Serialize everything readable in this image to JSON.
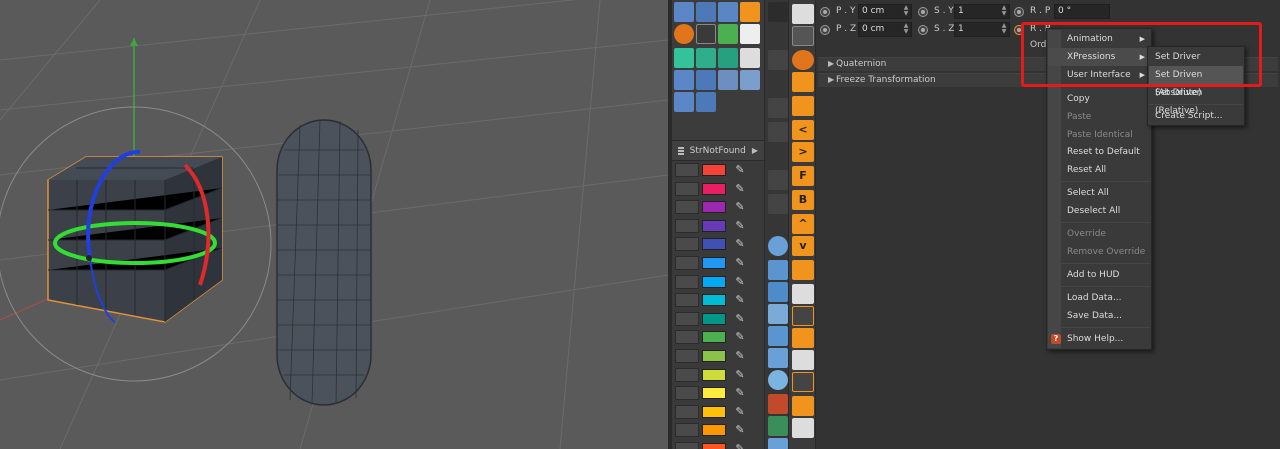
{
  "coords": {
    "row1": {
      "p_label": "P . Y",
      "p_value": "0 cm",
      "s_label": "S . Y",
      "s_value": "1",
      "r_label": "R . P",
      "r_value": "0 °"
    },
    "row2": {
      "p_label": "P . Z",
      "p_value": "0 cm",
      "s_label": "S . Z",
      "s_value": "1",
      "r_label": "R . B",
      "r_value": ""
    },
    "order_label": "Ord"
  },
  "groups": [
    {
      "label": "Quaternion"
    },
    {
      "label": "Freeze Transformation"
    }
  ],
  "layer_panel": {
    "header_label": "StrNotFound",
    "swatch_colors": [
      "#f44336",
      "#e91e63",
      "#9c27b0",
      "#673ab7",
      "#3f51b5",
      "#2196f3",
      "#03a9f4",
      "#00bcd4",
      "#009688",
      "#4caf50",
      "#8bc34a",
      "#cddc39",
      "#ffeb3b",
      "#ffc107",
      "#ff9800",
      "#ff5722"
    ]
  },
  "context_menu": {
    "items": [
      {
        "label": "Animation",
        "submenu": true
      },
      {
        "label": "XPressions",
        "submenu": true,
        "highlighted": true
      },
      {
        "label": "User Interface",
        "submenu": true
      },
      {
        "label": "Copy"
      },
      {
        "label": "Paste",
        "disabled": true
      },
      {
        "label": "Paste Identical",
        "disabled": true
      },
      {
        "label": "Reset to Default"
      },
      {
        "label": "Reset All"
      },
      {
        "label": "Select All"
      },
      {
        "label": "Deselect All"
      },
      {
        "label": "Override",
        "disabled": true
      },
      {
        "label": "Remove Override",
        "disabled": true
      },
      {
        "label": "Add to HUD"
      },
      {
        "label": "Load Data..."
      },
      {
        "label": "Save Data..."
      },
      {
        "label": "Show Help..."
      }
    ]
  },
  "xpressions_submenu": {
    "items": [
      {
        "label": "Set Driver"
      },
      {
        "label": "Set Driven (Absolute)",
        "highlighted": true
      },
      {
        "label": "Set Driven (Relative)"
      },
      {
        "label": "Create Script..."
      }
    ]
  },
  "colors": {
    "highlight_box": "#e21b1b",
    "accent_orange": "#f0941e",
    "viewport_bg": "#5a5a5a"
  }
}
